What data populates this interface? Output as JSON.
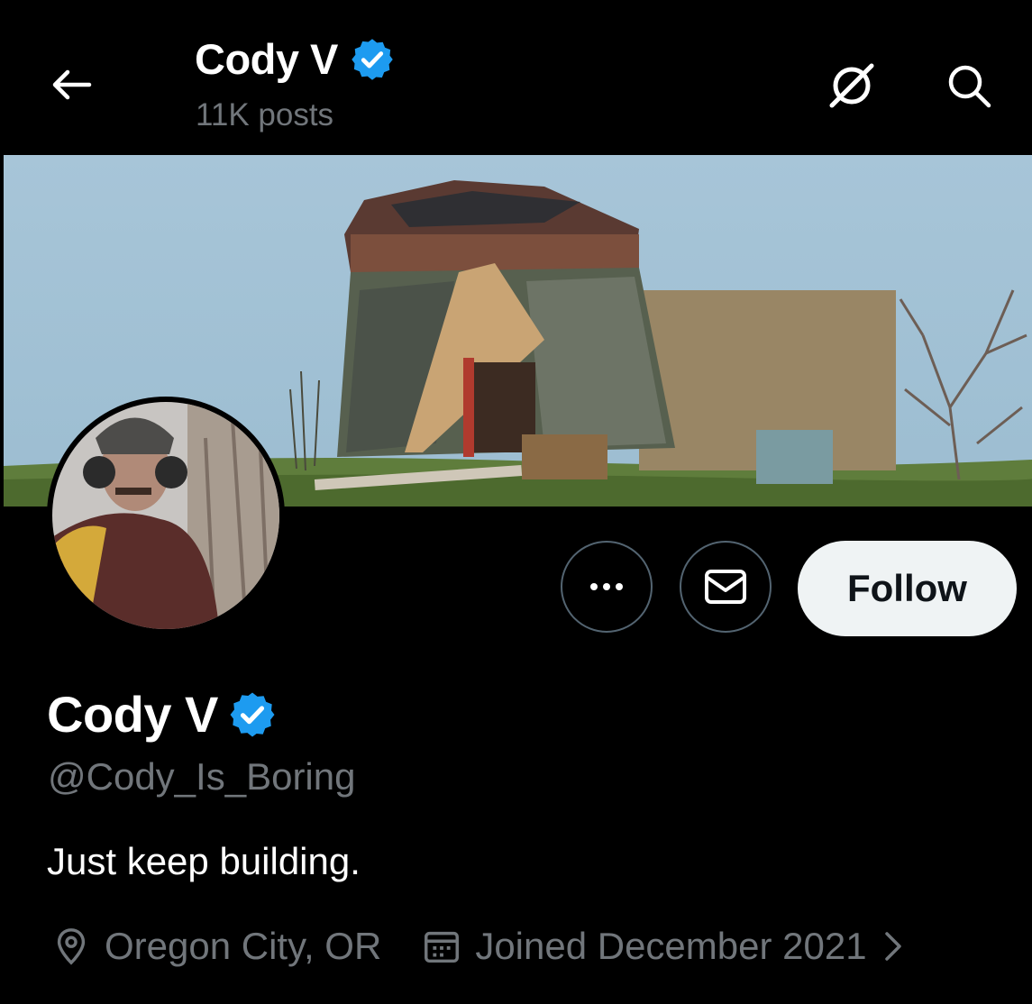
{
  "header": {
    "name": "Cody V",
    "posts": "11K posts",
    "icons": {
      "back": "back-arrow-icon",
      "grok": "grok-icon",
      "search": "search-icon",
      "verified": "verified-badge-icon"
    }
  },
  "profile": {
    "name": "Cody V",
    "handle": "@Cody_Is_Boring",
    "bio": "Just keep building.",
    "location": "Oregon City, OR",
    "joined": "Joined December 2021"
  },
  "actions": {
    "follow_label": "Follow",
    "icons": {
      "more": "more-icon",
      "message": "mail-icon"
    }
  },
  "colors": {
    "background": "#000000",
    "text_primary": "#ffffff",
    "text_secondary": "#71767b",
    "verified_blue": "#1d9bf0",
    "follow_button_bg": "#eff3f4"
  }
}
